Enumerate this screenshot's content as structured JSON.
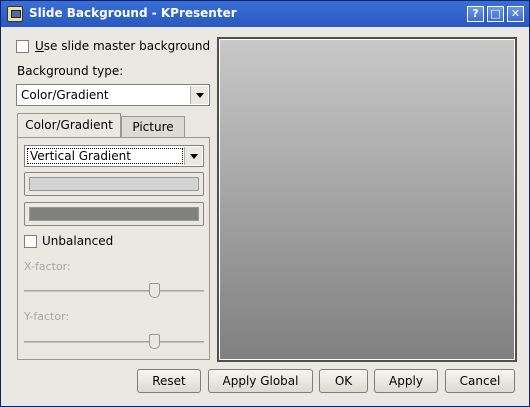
{
  "window": {
    "title": "Slide Background - KPresenter",
    "buttons": {
      "help": "?",
      "maximize": "□",
      "close": "✕"
    }
  },
  "settings": {
    "use_master_label": "Use slide master background",
    "use_master_checked": false,
    "background_type_label": "Background type:",
    "background_type_value": "Color/Gradient"
  },
  "tabs": [
    {
      "label": "Color/Gradient",
      "active": true
    },
    {
      "label": "Picture",
      "active": false
    }
  ],
  "gradient": {
    "type_value": "Vertical Gradient",
    "color1": "#d3d3d3",
    "color2": "#808080",
    "unbalanced_label": "Unbalanced",
    "unbalanced_checked": false,
    "xfactor_label": "X-factor:",
    "yfactor_label": "Y-factor:",
    "xfactor_level": 0.73,
    "yfactor_level": 0.73
  },
  "preview": {
    "gradient_top": "#c8c8c8",
    "gradient_bottom": "#808080"
  },
  "footer": {
    "reset": "Reset",
    "apply_global": "Apply Global",
    "ok": "OK",
    "apply": "Apply",
    "cancel": "Cancel"
  }
}
